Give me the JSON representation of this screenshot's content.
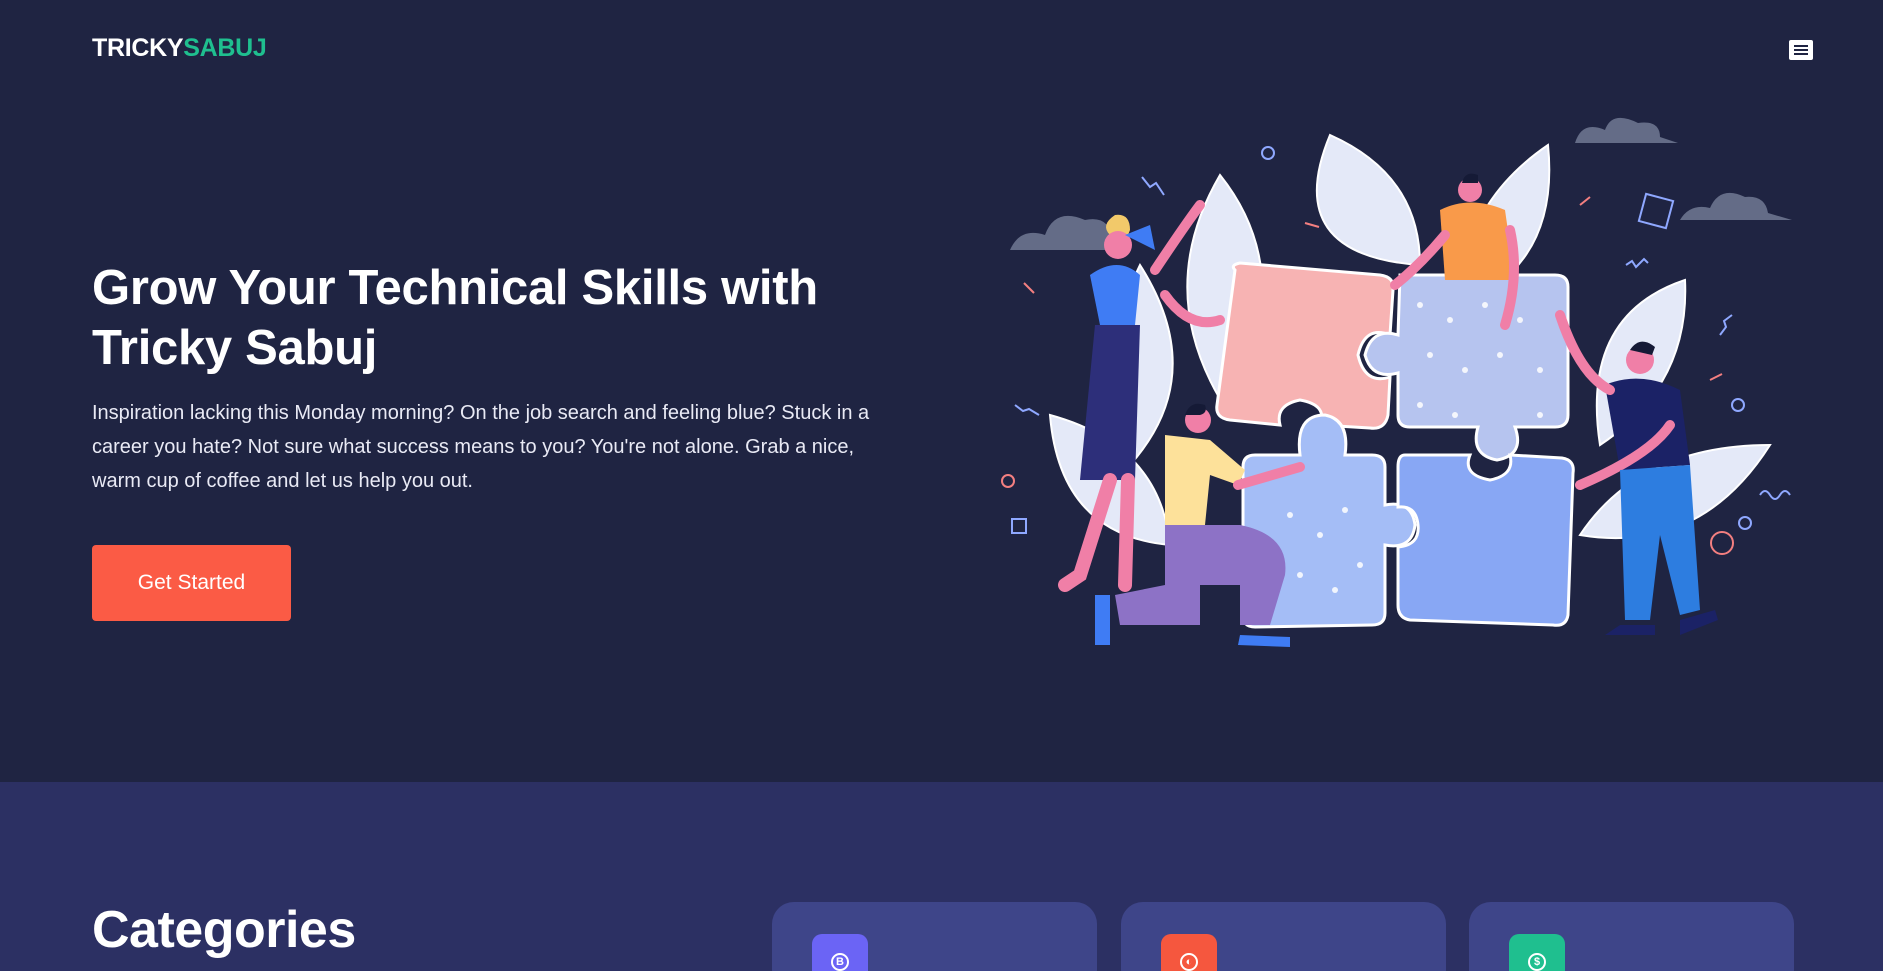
{
  "header": {
    "logo_part1": "TRICKY",
    "logo_part2": "SABUJ",
    "menu_icon": "hamburger-menu-icon"
  },
  "hero": {
    "title": "Grow Your Technical Skills with Tricky Sabuj",
    "description": "Inspiration lacking this Monday morning? On the job search and feeling blue? Stuck in a career you hate? Not sure what success means to you? You're not alone. Grab a nice, warm cup of coffee and let us help you out.",
    "cta_label": "Get Started",
    "illustration": "team-assembling-puzzle-illustration"
  },
  "categories": {
    "title": "Categories",
    "cards": [
      {
        "icon": "bitcoin-icon",
        "color": "#6b64f5",
        "glyph": "B"
      },
      {
        "icon": "palette-icon",
        "color": "#f5573e",
        "glyph": "◐"
      },
      {
        "icon": "dollar-icon",
        "color": "#1fbf8f",
        "glyph": "$"
      }
    ]
  },
  "colors": {
    "background": "#1f2442",
    "accent_green": "#1fbf8f",
    "accent_orange": "#fb5b45",
    "section_bg": "#2c3063",
    "card_bg": "#3e4589"
  }
}
